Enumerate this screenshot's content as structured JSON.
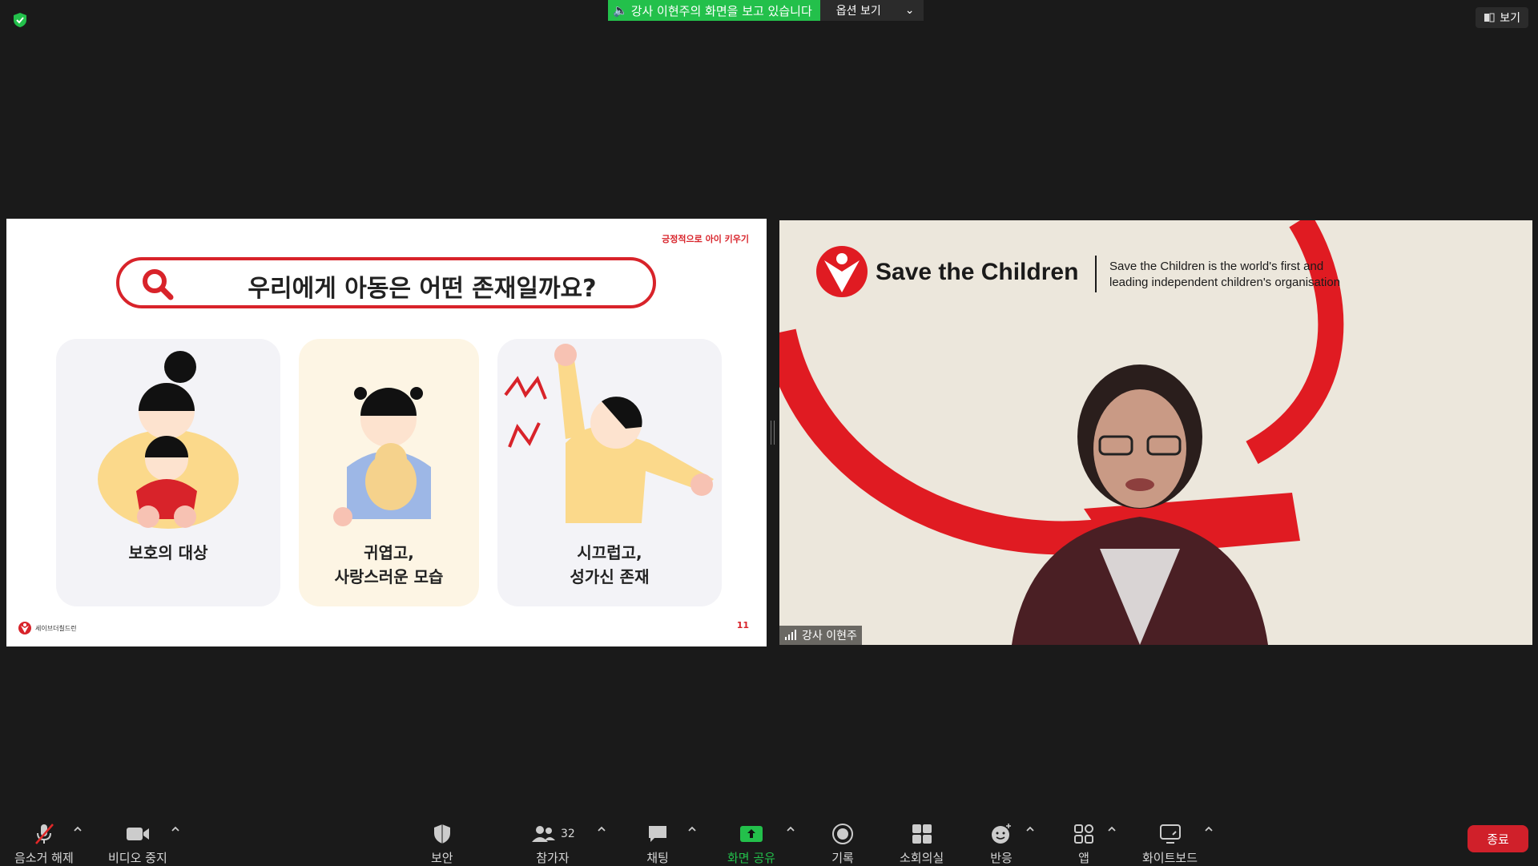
{
  "top": {
    "share_banner": "강사 이현주의 화면을 보고 있습니다",
    "view_options": "옵션 보기",
    "view_button": "보기"
  },
  "slide": {
    "top_label": "긍정적으로 아이 키우기",
    "question": "우리에게 아동은 어떤 존재일까요?",
    "cards": [
      {
        "line1": "보호의 대상",
        "line2": ""
      },
      {
        "line1": "귀엽고,",
        "line2": "사랑스러운 모습"
      },
      {
        "line1": "시끄럽고,",
        "line2": "성가신 존재"
      }
    ],
    "logo_text": "세이브더칠드런",
    "page_number": "11"
  },
  "video": {
    "org_name": "Save the Children",
    "tagline_1": "Save the Children is the world's first and",
    "tagline_2": "leading independent children's organisation",
    "participant_name": "강사 이현주"
  },
  "toolbar": {
    "unmute": "음소거 해제",
    "stop_video": "비디오 중지",
    "security": "보안",
    "participants": "참가자",
    "participants_count": "32",
    "chat": "채팅",
    "share_screen": "화면 공유",
    "record": "기록",
    "breakout": "소회의실",
    "reactions": "반응",
    "apps": "앱",
    "whiteboard": "화이트보드",
    "end": "종료"
  },
  "colors": {
    "brand_red": "#d8232a",
    "zoom_green": "#23c04b",
    "end_red": "#d0202a"
  }
}
